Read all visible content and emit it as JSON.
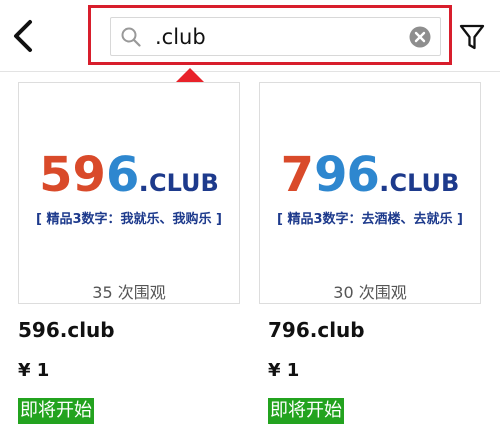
{
  "search": {
    "value": ".club"
  },
  "listings": [
    {
      "logo_digits_red": "59",
      "logo_digits_blue": "6",
      "logo_dot": ".",
      "logo_tld": "CLUB",
      "slogan": "[ 精品3数字：我就乐、我购乐 ]",
      "views": "35 次围观",
      "domain": "596.club",
      "price": "¥ 1",
      "status": "即将开始"
    },
    {
      "logo_digits_red": "7",
      "logo_digits_blue": "96",
      "logo_dot": ".",
      "logo_tld": "CLUB",
      "slogan": "[ 精品3数字：去酒楼、去就乐 ]",
      "views": "30 次围观",
      "domain": "796.club",
      "price": "¥ 1",
      "status": "即将开始"
    }
  ],
  "colors": {
    "highlight": "#d81e2c",
    "status_bg": "#23a31f",
    "logo_red": "#d94a2a",
    "logo_blue": "#2e87cf",
    "logo_navy": "#1d3a8c"
  }
}
